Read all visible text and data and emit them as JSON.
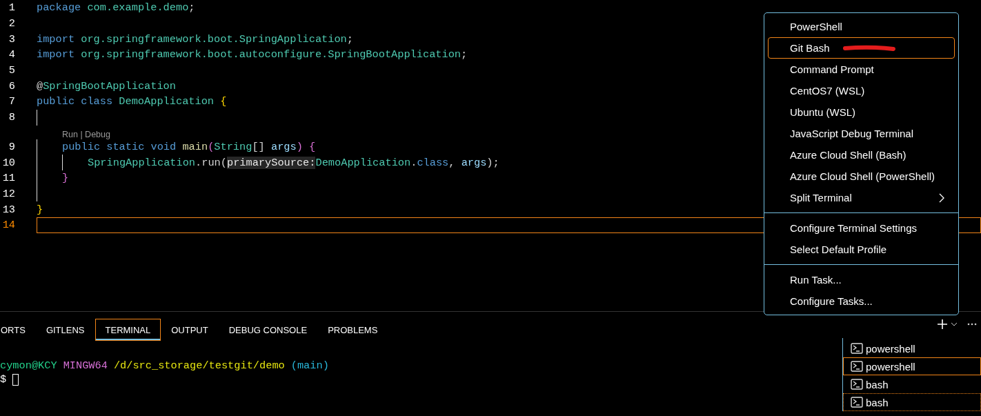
{
  "editor": {
    "lines": [
      {
        "kind": "code",
        "number": "1",
        "selected": false,
        "tokens": [
          {
            "t": "package",
            "kind": "keyword"
          },
          {
            "t": " com.example.demo",
            "kind": "ns"
          },
          {
            "t": ";",
            "kind": "punct"
          }
        ]
      },
      {
        "kind": "code",
        "number": "2",
        "selected": false
      },
      {
        "kind": "code",
        "number": "3",
        "selected": false,
        "tokens": [
          {
            "t": "import",
            "kind": "keyword"
          },
          {
            "t": " org.springframework.boot.SpringApplication",
            "kind": "ns"
          },
          {
            "t": ";",
            "kind": "punct"
          }
        ]
      },
      {
        "kind": "code",
        "number": "4",
        "selected": false,
        "tokens": [
          {
            "t": "import",
            "kind": "keyword"
          },
          {
            "t": " org.springframework.boot.autoconfigure.SpringBootApplication",
            "kind": "ns"
          },
          {
            "t": ";",
            "kind": "punct"
          }
        ]
      },
      {
        "kind": "code",
        "number": "5",
        "selected": false
      },
      {
        "kind": "code",
        "number": "6",
        "selected": false,
        "tokens": [
          {
            "t": "@",
            "kind": "punct"
          },
          {
            "t": "SpringBootApplication",
            "kind": "type"
          }
        ]
      },
      {
        "kind": "code",
        "number": "7",
        "selected": false,
        "tokens": [
          {
            "t": "public class",
            "kind": "keyword"
          },
          {
            "t": " DemoApplication ",
            "kind": "type"
          },
          {
            "t": "{",
            "kind": "brace"
          }
        ]
      },
      {
        "kind": "code",
        "number": "8",
        "selected": false,
        "indents": [
          {
            "guide": true
          }
        ]
      },
      {
        "kind": "codelens",
        "text": "Run | Debug"
      },
      {
        "kind": "code",
        "number": "9",
        "selected": false,
        "indents": [
          {
            "guide": true
          }
        ],
        "tokens": [
          {
            "t": "public static void",
            "kind": "keyword"
          },
          {
            "t": " main",
            "kind": "func"
          },
          {
            "t": "(",
            "kind": "brace2"
          },
          {
            "t": "String",
            "kind": "type"
          },
          {
            "t": "[] ",
            "kind": "punct"
          },
          {
            "t": "args",
            "kind": "var"
          },
          {
            "t": ")",
            "kind": "brace2"
          },
          {
            "t": " {",
            "kind": "brace2"
          }
        ]
      },
      {
        "kind": "code",
        "number": "10",
        "selected": false,
        "indents": [
          {
            "guide": true
          },
          {
            "guide": true
          }
        ],
        "tokens": [
          {
            "t": "SpringApplication",
            "kind": "type"
          },
          {
            "t": ".run(",
            "kind": "punct"
          },
          {
            "t": "primarySource:",
            "kind": "hint"
          },
          {
            "t": "DemoApplication",
            "kind": "type"
          },
          {
            "t": ".",
            "kind": "punct"
          },
          {
            "t": "class",
            "kind": "keyword"
          },
          {
            "t": ", ",
            "kind": "punct"
          },
          {
            "t": "args",
            "kind": "var"
          },
          {
            "t": ");",
            "kind": "punct"
          }
        ]
      },
      {
        "kind": "code",
        "number": "11",
        "selected": false,
        "indents": [
          {
            "guide": true
          }
        ],
        "tokens": [
          {
            "t": "}",
            "kind": "brace2"
          }
        ]
      },
      {
        "kind": "code",
        "number": "12",
        "selected": false,
        "indents": [
          {
            "guide": true
          }
        ]
      },
      {
        "kind": "code",
        "number": "13",
        "selected": false,
        "tokens": [
          {
            "t": "}",
            "kind": "brace"
          }
        ]
      },
      {
        "kind": "code",
        "number": "14",
        "selected": true
      }
    ]
  },
  "menu": {
    "items": [
      {
        "kind": "item",
        "label": "PowerShell",
        "selected": false
      },
      {
        "kind": "item",
        "label": "Git Bash",
        "selected": true,
        "marked": true
      },
      {
        "kind": "item",
        "label": "Command Prompt",
        "selected": false
      },
      {
        "kind": "item",
        "label": "CentOS7 (WSL)",
        "selected": false
      },
      {
        "kind": "item",
        "label": "Ubuntu (WSL)",
        "selected": false
      },
      {
        "kind": "item",
        "label": "JavaScript Debug Terminal",
        "selected": false
      },
      {
        "kind": "item",
        "label": "Azure Cloud Shell (Bash)",
        "selected": false
      },
      {
        "kind": "item",
        "label": "Azure Cloud Shell (PowerShell)",
        "selected": false
      },
      {
        "kind": "item",
        "label": "Split Terminal",
        "selected": false,
        "submenu": true
      },
      {
        "kind": "separator"
      },
      {
        "kind": "item",
        "label": "Configure Terminal Settings",
        "selected": false
      },
      {
        "kind": "item",
        "label": "Select Default Profile",
        "selected": false
      },
      {
        "kind": "separator"
      },
      {
        "kind": "item",
        "label": "Run Task...",
        "selected": false
      },
      {
        "kind": "item",
        "label": "Configure Tasks...",
        "selected": false
      }
    ]
  },
  "panel": {
    "tabs": [
      {
        "label": "ORTS",
        "selected": false
      },
      {
        "label": "GITLENS",
        "selected": false
      },
      {
        "label": "TERMINAL",
        "selected": true
      },
      {
        "label": "OUTPUT",
        "selected": false
      },
      {
        "label": "DEBUG CONSOLE",
        "selected": false
      },
      {
        "label": "PROBLEMS",
        "selected": false
      }
    ],
    "terminal": {
      "prompt": [
        {
          "text": "cymon@KCY",
          "color": "#23d18b"
        },
        {
          "text": "MINGW64",
          "color": "#d670d6"
        },
        {
          "text": "/d/src_storage/testgit/demo",
          "color": "#e5e510"
        },
        {
          "text": "(main)",
          "color": "#29b8db"
        }
      ],
      "input_prompt": "$"
    },
    "terminals": [
      {
        "label": "powershell",
        "selected": false,
        "focused": false
      },
      {
        "label": "powershell",
        "selected": true,
        "focused": false
      },
      {
        "label": "bash",
        "selected": false,
        "focused": false
      },
      {
        "label": "bash",
        "selected": false,
        "focused": true
      }
    ]
  }
}
